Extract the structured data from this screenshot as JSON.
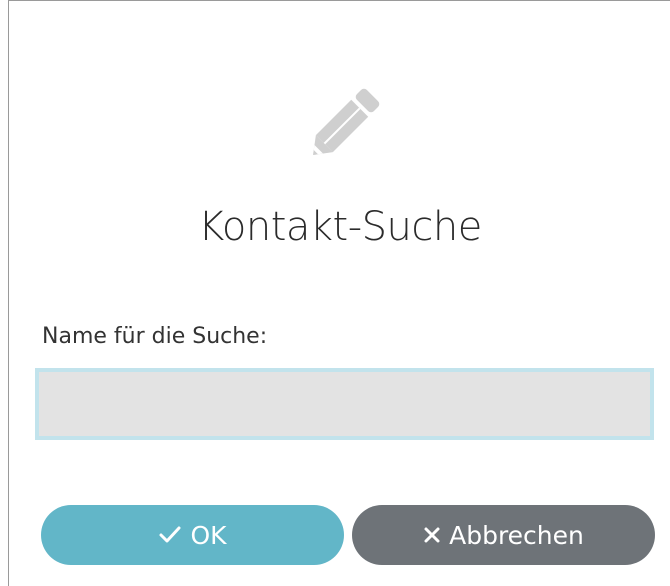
{
  "dialog": {
    "icon": "pencil-icon",
    "title": "Kontakt-Suche",
    "field_label": "Name für die Suche:",
    "search_value": "",
    "search_placeholder": ""
  },
  "buttons": {
    "ok": {
      "icon": "check-icon",
      "label": "OK"
    },
    "cancel": {
      "icon": "close-icon",
      "label": "Abbrechen"
    }
  },
  "colors": {
    "ok_button": "#62b6c8",
    "cancel_button": "#6e7378",
    "input_background": "#e3e3e3",
    "input_border": "#c2e3ec",
    "icon": "#cfcfcf"
  }
}
